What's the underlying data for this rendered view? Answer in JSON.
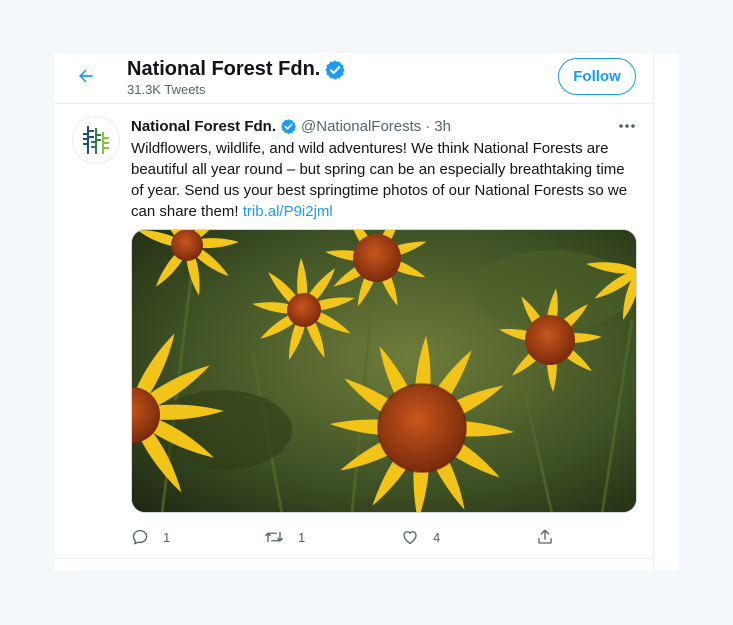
{
  "header": {
    "name": "National Forest Fdn.",
    "tweet_count": "31.3K Tweets",
    "follow_label": "Follow"
  },
  "tweet": {
    "name": "National Forest Fdn.",
    "handle": "@NationalForests",
    "separator": "·",
    "time": "3h",
    "text": "Wildflowers, wildlife, and wild adventures! We think National Forests are beautiful all year round – but spring can be an especially breathtaking time of year. Send us your best springtime photos of our National Forests so we can share them!",
    "link": "trib.al/P9i2jml",
    "actions": {
      "reply_count": "1",
      "retweet_count": "1",
      "like_count": "4"
    }
  },
  "colors": {
    "accent": "#1d9bf0",
    "text": "#0f1419",
    "secondary": "#536471",
    "brand_green": "#2e7d4f",
    "brand_blue": "#1f4e79"
  },
  "icons": [
    "back-arrow-icon",
    "verified-badge-icon",
    "more-icon",
    "reply-icon",
    "retweet-icon",
    "like-icon",
    "share-icon"
  ]
}
